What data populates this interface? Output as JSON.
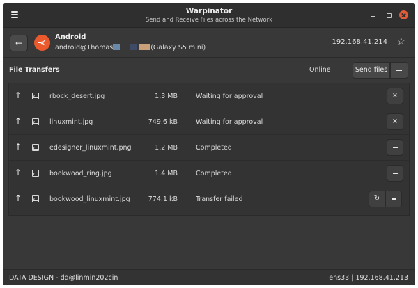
{
  "window": {
    "title": "Warpinator",
    "subtitle": "Send and Receive Files across the Network",
    "menu_icon": "hamburger-menu-icon",
    "controls": [
      "minimize-icon",
      "maximize-icon",
      "close-icon"
    ],
    "close_color": "#e55b38"
  },
  "peer": {
    "back_glyph": "←",
    "name": "Android",
    "user_prefix": "android@Thomas",
    "user_suffix": "(Galaxy S5 mini)",
    "ip": "192.168.41.214",
    "star_glyph": "☆",
    "avatar_color": "#ea5a2c"
  },
  "toolbar": {
    "section_label": "File Transfers",
    "status": "Online",
    "send_label": "Send files"
  },
  "transfers": [
    {
      "dir": "↑",
      "name": "rbock_desert.jpg",
      "size": "1.3 MB",
      "status": "Waiting for approval",
      "actions": [
        "cancel"
      ]
    },
    {
      "dir": "↑",
      "name": "linuxmint.jpg",
      "size": "749.6 kB",
      "status": "Waiting for approval",
      "actions": [
        "cancel"
      ]
    },
    {
      "dir": "↑",
      "name": "edesigner_linuxmint.png",
      "size": "1.2 MB",
      "status": "Completed",
      "actions": [
        "remove"
      ]
    },
    {
      "dir": "↑",
      "name": "bookwood_ring.jpg",
      "size": "1.4 MB",
      "status": "Completed",
      "actions": [
        "remove"
      ]
    },
    {
      "dir": "↑",
      "name": "bookwood_linuxmint.jpg",
      "size": "774.1 kB",
      "status": "Transfer failed",
      "actions": [
        "retry",
        "remove"
      ]
    }
  ],
  "glyphs": {
    "cancel": "×",
    "retry": "↻"
  },
  "statusbar": {
    "left": "DATA DESIGN - dd@linmin202cin",
    "right": "ens33  |  192.168.41.213"
  }
}
